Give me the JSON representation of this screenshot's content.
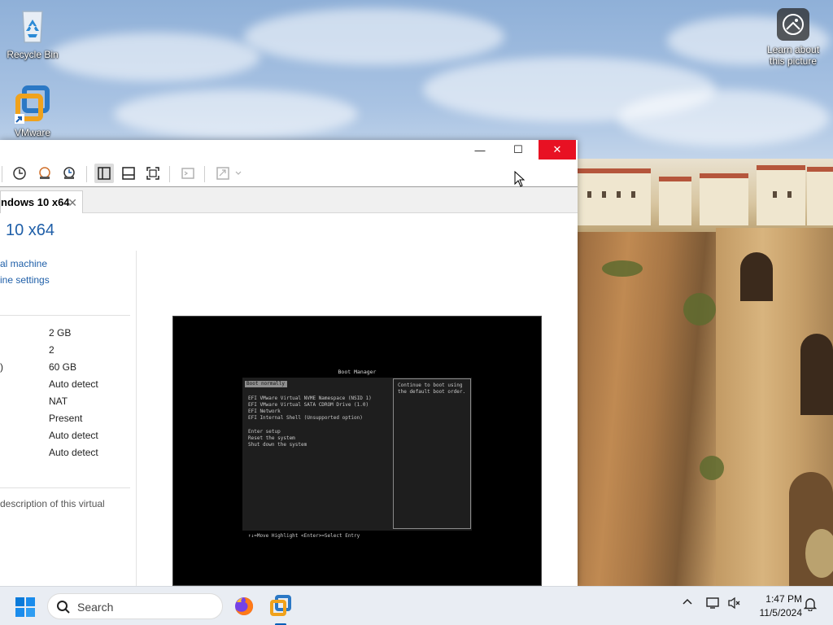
{
  "desktop": {
    "icons": [
      {
        "label": "Recycle Bin"
      },
      {
        "label": "VMware"
      }
    ],
    "learn_about": "Learn about this picture"
  },
  "vmware": {
    "window_controls": {
      "minimize": "—",
      "maximize": "☐",
      "close": "✕"
    },
    "tab_label": "ndows 10 x64",
    "vm_title": "10 x64",
    "links": [
      "al machine",
      "ine settings"
    ],
    "devices": [
      {
        "label": "",
        "value": "2 GB"
      },
      {
        "label": "",
        "value": "2"
      },
      {
        "label": ")",
        "value": "60 GB"
      },
      {
        "label": "",
        "value": "Auto detect"
      },
      {
        "label": "",
        "value": "NAT"
      },
      {
        "label": "",
        "value": "Present"
      },
      {
        "label": "",
        "value": "Auto detect"
      },
      {
        "label": "",
        "value": "Auto detect"
      }
    ],
    "description": "description of this virtual"
  },
  "boot_manager": {
    "title": "Boot Manager",
    "selected": "Boot normally",
    "entries": [
      "EFI VMware Virtual NVME Namespace (NSID 1)",
      "EFI VMware Virtual SATA CDROM Drive (1.0)",
      "EFI Network",
      "EFI Internal Shell (Unsupported option)"
    ],
    "actions": [
      "Enter setup",
      "Reset the system",
      "Shut down the system"
    ],
    "help_text": "Continue to boot using the default boot order.",
    "footer": "↑↓=Move Highlight      <Enter>=Select Entry"
  },
  "taskbar": {
    "search_label": "Search",
    "time": "1:47 PM",
    "date": "11/5/2024"
  },
  "colors": {
    "accent": "#1f5fa8",
    "close_red": "#e81123",
    "taskbar_bg": "#e9edf3"
  }
}
